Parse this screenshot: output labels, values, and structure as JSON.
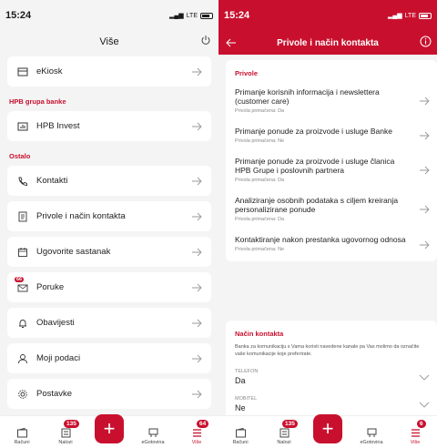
{
  "left": {
    "status": {
      "time": "15:24",
      "network": "LTE"
    },
    "header": {
      "title": "Više"
    },
    "top_item": {
      "label": "eKiosk"
    },
    "sections": [
      {
        "title": "HPB grupa banke"
      },
      {
        "title": "Ostalo"
      }
    ],
    "group_item": {
      "label": "HPB Invest"
    },
    "items": [
      {
        "label": "Kontakti",
        "icon": "phone-icon"
      },
      {
        "label": "Privole i način kontakta",
        "icon": "document-icon"
      },
      {
        "label": "Ugovorite sastanak",
        "icon": "calendar-icon"
      },
      {
        "label": "Poruke",
        "icon": "mail-icon",
        "badge": "66"
      },
      {
        "label": "Obavijesti",
        "icon": "bell-icon"
      },
      {
        "label": "Moji podaci",
        "icon": "user-icon"
      },
      {
        "label": "Postavke",
        "icon": "gear-icon"
      }
    ],
    "nav": {
      "racuni": "Računi",
      "nalozi": "Nalozi",
      "nalozi_badge": "135",
      "egotovina": "eGotovina",
      "vise": "Više",
      "vise_badge": "64"
    }
  },
  "right": {
    "status": {
      "time": "15:24",
      "network": "LTE"
    },
    "header": {
      "title": "Privole i način kontakta"
    },
    "privole": {
      "title": "Privole",
      "items": [
        {
          "title": "Primanje korisnih informacija i newslettera (customer care)",
          "status": "Privola primačena: Da"
        },
        {
          "title": "Primanje ponude za proizvode i usluge Banke",
          "status": "Privola primačena: Ne"
        },
        {
          "title": "Primanje ponude za proizvode i usluge članica HPB Grupe i poslovnih partnera",
          "status": "Privola primačena: Da"
        },
        {
          "title": "Analiziranje osobnih podataka s ciljem kreiranja personalizirane ponude",
          "status": "Privola primačena: Da"
        },
        {
          "title": "Kontaktiranje nakon prestanka ugovornog odnosa",
          "status": "Privola primačena: Ne"
        }
      ]
    },
    "kontakt": {
      "title": "Način kontakta",
      "description": "Banka za komunikaciju s Vama koristi navedene kanale pa Vas molimo da označite vaše komunikacije koje preferirate.",
      "fields": [
        {
          "label": "TELEFON",
          "value": "Da"
        },
        {
          "label": "MOBITEL",
          "value": "Ne"
        }
      ]
    },
    "nav": {
      "racuni": "Računi",
      "nalozi": "Nalozi",
      "nalozi_badge": "135",
      "egotovina": "eGotovina",
      "vise": "Više",
      "vise_badge": "6"
    }
  },
  "colors": {
    "accent": "#c8102e",
    "background": "#f4f4f4"
  }
}
